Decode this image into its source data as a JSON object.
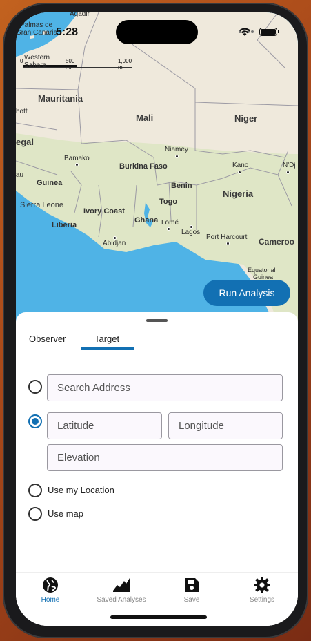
{
  "status": {
    "time": "5:28"
  },
  "map": {
    "scale_labels": [
      "0",
      "500 mi",
      "1,000 mi"
    ],
    "labels": {
      "agadir": "Agadir",
      "las_palmas": "Palmas de",
      "gran_canaria": "Gran Canaria",
      "western": "Western",
      "sahara": "Sahara",
      "mauritania": "Mauritania",
      "nouakchott": "hott",
      "senegal": "egal",
      "mali": "Mali",
      "niger": "Niger",
      "niamey": "Niamey",
      "bamako": "Bamako",
      "burkina_faso": "Burkina Faso",
      "kano": "Kano",
      "ndjamena": "N'Dj",
      "guinea_bissau": "au",
      "guinea": "Guinea",
      "benin": "Benin",
      "nigeria": "Nigeria",
      "sierra_leone": "Sierra Leone",
      "ivory_coast": "Ivory Coast",
      "togo": "Togo",
      "liberia": "Liberia",
      "ghana": "Ghana",
      "lome": "Lomé",
      "lagos": "Lagos",
      "port_harcourt": "Port Harcourt",
      "cameroon": "Cameroo",
      "abidjan": "Abidjan",
      "equatorial": "Equatorial",
      "guinea_eq": "Guinea"
    },
    "run_button": "Run Analysis"
  },
  "sheet": {
    "tabs": [
      {
        "label": "Observer",
        "active": false
      },
      {
        "label": "Target",
        "active": true
      }
    ],
    "options": {
      "search_address": {
        "selected": false,
        "placeholder": "Search Address"
      },
      "coordinates": {
        "selected": true,
        "latitude_placeholder": "Latitude",
        "longitude_placeholder": "Longitude",
        "elevation_placeholder": "Elevation"
      },
      "use_my_location": {
        "selected": false,
        "label": "Use my Location"
      },
      "use_map": {
        "selected": false,
        "label": "Use map"
      }
    }
  },
  "nav": {
    "items": [
      {
        "label": "Home",
        "icon": "globe-icon",
        "active": true
      },
      {
        "label": "Saved Analyses",
        "icon": "chart-area-icon",
        "active": false
      },
      {
        "label": "Save",
        "icon": "floppy-disk-icon",
        "active": false
      },
      {
        "label": "Settings",
        "icon": "gear-icon",
        "active": false
      }
    ]
  },
  "colors": {
    "accent": "#1270b3",
    "ocean": "#4fb3e6",
    "land": "#dfe6c6",
    "desert": "#efe9dc",
    "inactive_nav": "#888888"
  }
}
